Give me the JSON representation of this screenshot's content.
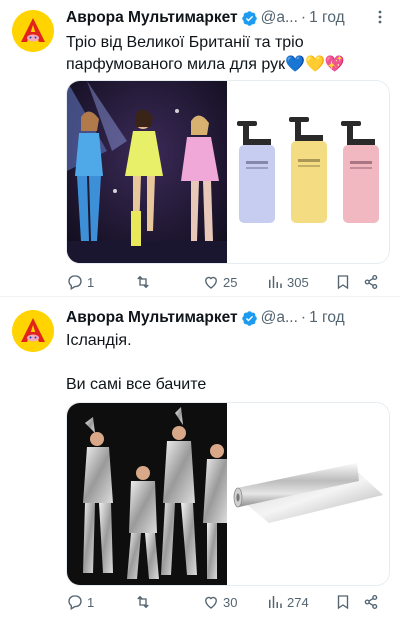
{
  "tweets": [
    {
      "author": "Аврора Мультимаркет",
      "handle": "@a...",
      "time": "1 год",
      "text": "Тріо від Великої Британії та тріо парфумованого мила для рук💙💛💖",
      "replies": "1",
      "retweets": "",
      "likes": "25",
      "views": "305"
    },
    {
      "author": "Аврора Мультимаркет",
      "handle": "@a...",
      "time": "1 год",
      "text_line1": "Ісландія.",
      "text_line2": "Ви самі все бачите",
      "replies": "1",
      "retweets": "",
      "likes": "30",
      "views": "274"
    }
  ],
  "colors": {
    "verified": "#1d9bf0",
    "avatar_bg": "#ffd400",
    "avatar_letter": "#e2231a",
    "icon_gray": "#536471"
  },
  "icons": [
    "verified-badge-icon",
    "more-icon",
    "reply-icon",
    "retweet-icon",
    "like-icon",
    "views-icon",
    "bookmark-icon",
    "share-icon"
  ]
}
